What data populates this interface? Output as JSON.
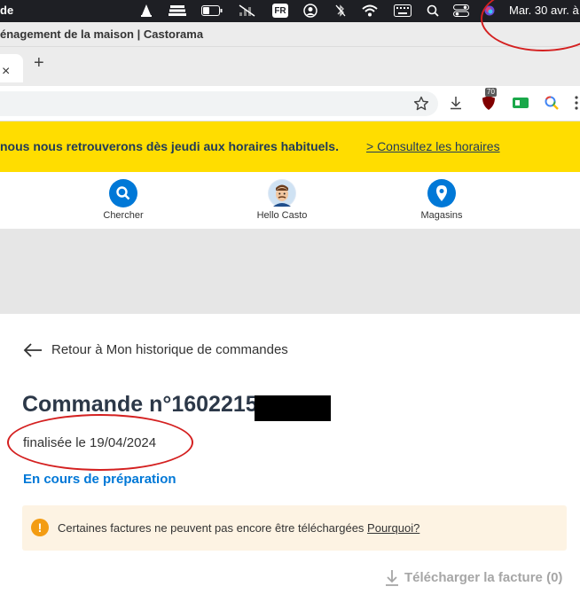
{
  "menubar": {
    "app_name": "de",
    "keyboard_badge": "FR",
    "clock": "Mar. 30 avr. à",
    "icons": [
      "vlc-icon",
      "stack-icon",
      "battery-icon",
      "signal-off-icon",
      "keyboard-input-icon",
      "user-icon",
      "bluetooth-icon",
      "wifi-icon",
      "keyboard-icon",
      "search-icon",
      "control-center-icon",
      "siri-icon"
    ]
  },
  "window": {
    "title": "énagement de la maison | Castorama"
  },
  "tabs": {
    "close_glyph": "×",
    "new_tab_glyph": "+"
  },
  "toolbar": {
    "extension_badge": "70",
    "icons": [
      "bookmark-star-icon",
      "download-icon",
      "ublock-icon",
      "green-extension-icon",
      "search-lens-icon",
      "more-icon"
    ]
  },
  "banner": {
    "message": "nous nous retrouverons dès jeudi aux horaires habituels.",
    "link": "> Consultez les horaires",
    "background": "#ffdd00"
  },
  "nav": {
    "items": [
      {
        "label": "Chercher",
        "icon": "search-icon"
      },
      {
        "label": "Hello Casto",
        "icon": "avatar"
      },
      {
        "label": "Magasins",
        "icon": "location-pin-icon"
      }
    ],
    "accent": "#0078d7"
  },
  "order": {
    "back_label": "Retour à Mon historique de commandes",
    "title": "Commande n°1602215",
    "finalized": "finalisée le 19/04/2024",
    "status": "En cours de préparation"
  },
  "alert": {
    "text": "Certaines factures ne peuvent pas encore être téléchargées ",
    "link": "Pourquoi?"
  },
  "download": {
    "label": "Télécharger la facture (0)"
  }
}
